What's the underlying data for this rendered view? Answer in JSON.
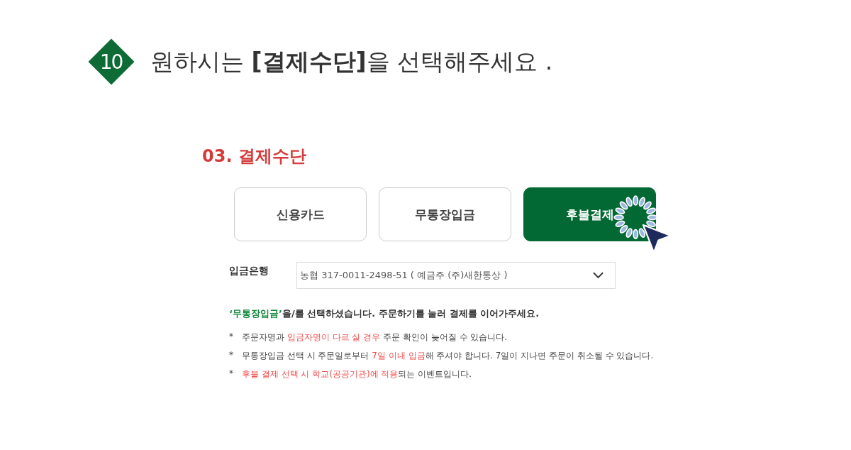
{
  "step": {
    "number": "10",
    "title": "원하시는 **[결제수단]**을 선택해주세요 ."
  },
  "section": {
    "title": "03. 결제수단"
  },
  "payment_options": [
    {
      "label": "신용카드",
      "selected": false
    },
    {
      "label": "무통장입금",
      "selected": false
    },
    {
      "label": "후불결제",
      "selected": true
    }
  ],
  "bank": {
    "label": "입금은행",
    "value": "농협 317-0011-2498-51 ( 예금주 (주)새한통상 )"
  },
  "message": [
    {
      "text": "‘무통장입금’",
      "highlight": true
    },
    {
      "text": "을/를 선택하셨습니다. 주문하기를 눌러 결제를 이어가주세요.",
      "highlight": false
    }
  ],
  "notes": [
    {
      "marker": "*",
      "parts": [
        {
          "text": "주문자명과 ",
          "highlight": false
        },
        {
          "text": "입금자명이 다르 실 경우",
          "highlight": true
        },
        {
          "text": " 주문 확인이 늦어질 수 있습니다.",
          "highlight": false
        }
      ]
    },
    {
      "marker": "*",
      "parts": [
        {
          "text": "무통장입금 선택 시 주문일로부터 ",
          "highlight": false
        },
        {
          "text": "7일 이내 입금",
          "highlight": true
        },
        {
          "text": "해 주셔야 합니다. 7일이 지나면 주문이 취소될 수 있습니다.",
          "highlight": false
        }
      ]
    },
    {
      "marker": "*",
      "parts": [
        {
          "text": "후불 결제 선택 시 학교(공공기관)에 적용",
          "highlight": true
        },
        {
          "text": "되는 이벤트입니다.",
          "highlight": false
        }
      ]
    }
  ]
}
